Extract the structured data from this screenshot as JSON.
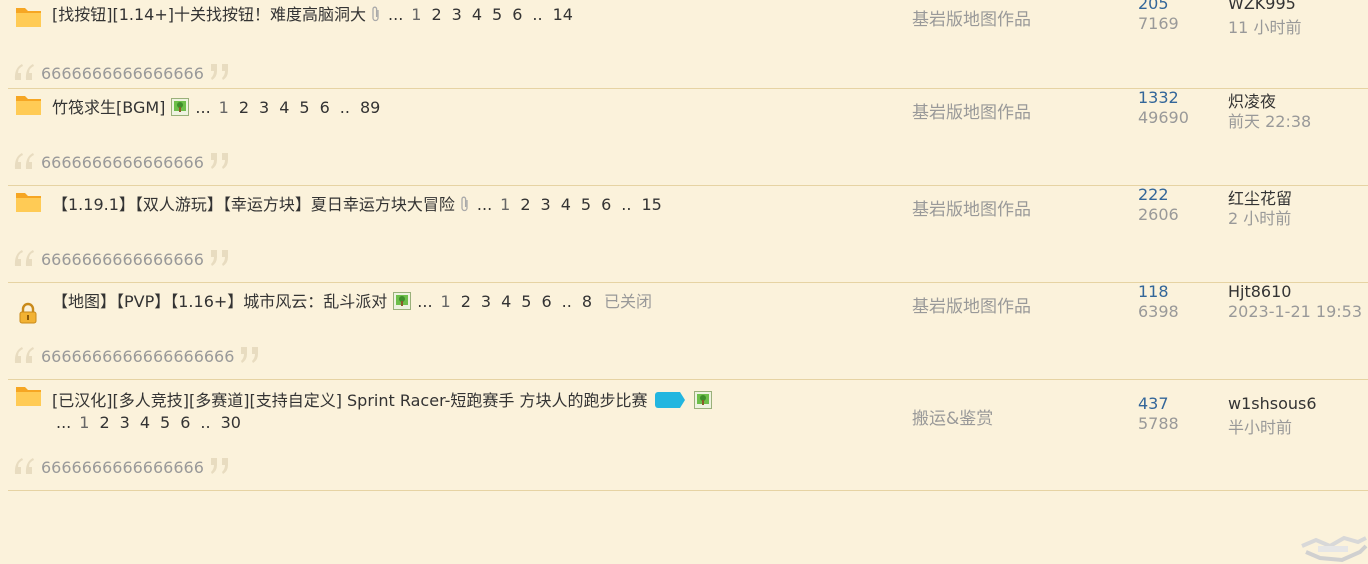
{
  "threads": [
    {
      "icon": "folder-icon",
      "title": "[找按钮][1.14+]十关找按钮！难度高脑洞大",
      "attachment": true,
      "image": false,
      "jing": false,
      "pages": [
        "1",
        "2",
        "3",
        "4",
        "5",
        "6"
      ],
      "last_page": "14",
      "closed": "",
      "forum": "基岩版地图作品",
      "replies": "205",
      "views": "7169",
      "author": "WZK995",
      "last_time": "11 小时前",
      "preview": "6666666666666666"
    },
    {
      "icon": "folder-icon",
      "title": "竹筏求生[BGM]",
      "attachment": false,
      "image": true,
      "jing": false,
      "pages": [
        "1",
        "2",
        "3",
        "4",
        "5",
        "6"
      ],
      "last_page": "89",
      "closed": "",
      "forum": "基岩版地图作品",
      "replies": "1332",
      "views": "49690",
      "author": "炽凌夜",
      "last_time": "前天 22:38",
      "preview": "6666666666666666"
    },
    {
      "icon": "folder-icon",
      "title": "【1.19.1】【双人游玩】【幸运方块】夏日幸运方块大冒险",
      "attachment": true,
      "image": false,
      "jing": false,
      "pages": [
        "1",
        "2",
        "3",
        "4",
        "5",
        "6"
      ],
      "last_page": "15",
      "closed": "",
      "forum": "基岩版地图作品",
      "replies": "222",
      "views": "2606",
      "author": "红尘花留",
      "last_time": "2 小时前",
      "preview": "6666666666666666"
    },
    {
      "icon": "lock-icon",
      "title": "【地图】【PVP】【1.16+】城市风云：乱斗派对",
      "attachment": false,
      "image": true,
      "jing": false,
      "pages": [
        "1",
        "2",
        "3",
        "4",
        "5",
        "6"
      ],
      "last_page": "8",
      "closed": "已关闭",
      "forum": "基岩版地图作品",
      "replies": "118",
      "views": "6398",
      "author": "Hjt8610",
      "last_time": "2023-1-21 19:53",
      "preview": "6666666666666666666"
    },
    {
      "icon": "folder-icon",
      "title": "[已汉化][多人竞技][多赛道][支持自定义] Sprint Racer-短跑赛手 方块人的跑步比赛",
      "attachment": false,
      "image": true,
      "jing": true,
      "jing_label": "精",
      "pages": [
        "1",
        "2",
        "3",
        "4",
        "5",
        "6"
      ],
      "last_page": "30",
      "closed": "",
      "forum": "搬运&鉴赏",
      "replies": "437",
      "views": "5788",
      "author": "w1shsous6",
      "last_time": "半小时前",
      "preview": "6666666666666666"
    }
  ],
  "ellipsis": "...",
  "dotdot": "..",
  "colors": {
    "background": "#fbf2db",
    "separator": "#e6d3a3",
    "reply_count": "#336699",
    "muted": "#999999"
  }
}
